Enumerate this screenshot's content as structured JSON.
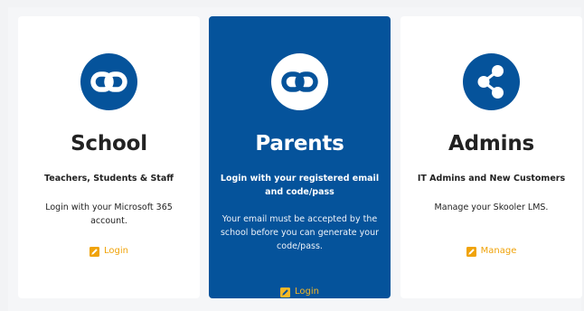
{
  "colors": {
    "brand_blue": "#05539b",
    "accent_orange": "#f0a30a",
    "card_bg": "#ffffff",
    "page_bg": "#f2f3f5"
  },
  "cards": [
    {
      "icon": "infinity-icon",
      "title": "School",
      "subtitle": "Teachers, Students & Staff",
      "description": "Login with your Microsoft 365 account.",
      "action_icon": "edit-icon",
      "action_label": "Login"
    },
    {
      "icon": "infinity-icon",
      "title": "Parents",
      "subtitle": "Login with your registered email and code/pass",
      "description": "Your email must be accepted by the school before you can generate your code/pass.",
      "action_icon": "edit-icon",
      "action_label": "Login"
    },
    {
      "icon": "share-icon",
      "title": "Admins",
      "subtitle": "IT Admins and New Customers",
      "description": "Manage your Skooler LMS.",
      "action_icon": "edit-icon",
      "action_label": "Manage"
    }
  ]
}
